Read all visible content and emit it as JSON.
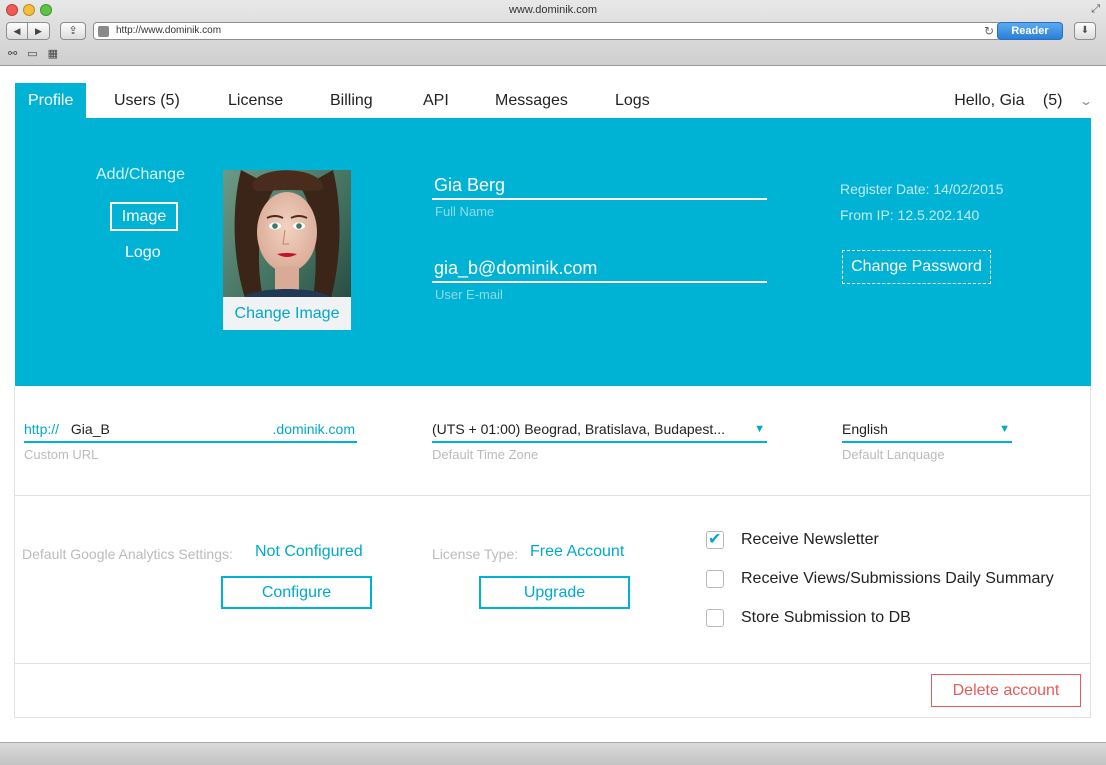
{
  "browser": {
    "window_title": "www.dominik.com",
    "url": "http://www.dominik.com",
    "reader_label": "Reader"
  },
  "tabs": [
    {
      "label": "Profile",
      "active": true
    },
    {
      "label": "Users (5)"
    },
    {
      "label": "License"
    },
    {
      "label": "Billing"
    },
    {
      "label": "API"
    },
    {
      "label": "Messages"
    },
    {
      "label": "Logs"
    }
  ],
  "header": {
    "greeting": "Hello, Gia",
    "notifications": "(5)"
  },
  "profile": {
    "add_change": "Add/Change",
    "image_label": "Image",
    "logo_label": "Logo",
    "change_image": "Change Image",
    "full_name": "Gia Berg",
    "full_name_label": "Full Name",
    "email": "gia_b@dominik.com",
    "email_label": "User E-mail",
    "register_date": "Register Date: 14/02/2015",
    "from_ip": "From IP: 12.5.202.140",
    "change_password": "Change Password"
  },
  "settings": {
    "url_prefix": "http://",
    "url_value": "Gia_B",
    "url_suffix": ".dominik.com",
    "url_label": "Custom URL",
    "timezone": "(UTS + 01:00) Beograd, Bratislava, Budapest...",
    "timezone_label": "Default Time Zone",
    "language": "English",
    "language_label": "Default Lanquage"
  },
  "account": {
    "ga_label": "Default Google Analytics Settings:",
    "ga_value": "Not Configured",
    "configure_label": "Configure",
    "license_label": "License Type:",
    "license_value": "Free Account",
    "upgrade_label": "Upgrade",
    "options": [
      {
        "label": "Receive Newsletter",
        "checked": true
      },
      {
        "label": "Receive Views/Submissions Daily Summary",
        "checked": false
      },
      {
        "label": "Store Submission to DB",
        "checked": false
      }
    ]
  },
  "danger": {
    "delete_label": "Delete account"
  },
  "colors": {
    "accent": "#00b2d3",
    "danger": "#ea5a5a"
  }
}
